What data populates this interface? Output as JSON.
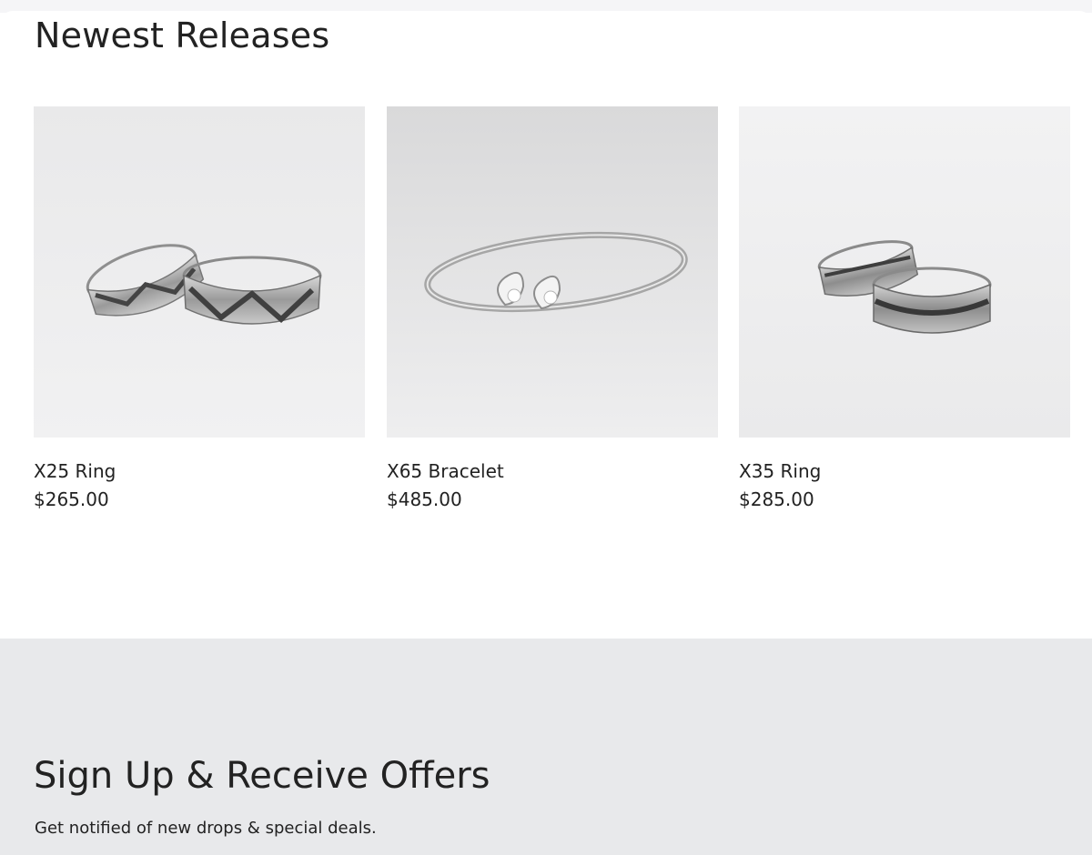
{
  "newest": {
    "title": "Newest Releases",
    "products": [
      {
        "name": "X25 Ring",
        "price": "$265.00",
        "image": "two-silver-rings-with-chevron-pattern"
      },
      {
        "name": "X65 Bracelet",
        "price": "$485.00",
        "image": "silver-bangle-with-twin-pear-stones"
      },
      {
        "name": "X35 Ring",
        "price": "$285.00",
        "image": "two-stacked-silver-band-rings"
      }
    ]
  },
  "signup": {
    "title": "Sign Up & Receive Offers",
    "subtitle": "Get notified of new drops & special deals."
  },
  "colors": {
    "page_background": "#ffffff",
    "signup_background": "#e8e9eb",
    "text": "#222222"
  }
}
